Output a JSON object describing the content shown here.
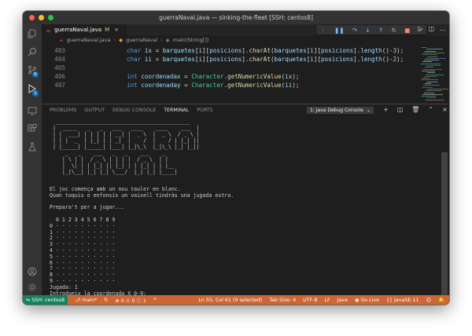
{
  "window": {
    "title": "guerraNaval.java — sinking-the-fleet [SSH: centos8]"
  },
  "tab": {
    "label": "guerraNaval.java",
    "modified": "M",
    "close": "×"
  },
  "breadcrumb": {
    "file": "guerraNaval.java",
    "class": "guerraNaval",
    "method": "main(String[])"
  },
  "activity_badges": {
    "scm": "6",
    "debug": "1"
  },
  "code_lines": [
    {
      "n": "403",
      "parts": [
        [
          "kw",
          "char "
        ],
        [
          "id",
          "ix"
        ],
        [
          "pl",
          " = "
        ],
        [
          "id",
          "barquetes"
        ],
        [
          "pl",
          "["
        ],
        [
          "id",
          "i"
        ],
        [
          "pl",
          "]["
        ],
        [
          "id",
          "posicions"
        ],
        [
          "pl",
          "]."
        ],
        [
          "fn",
          "charAt"
        ],
        [
          "pl",
          "("
        ],
        [
          "id",
          "barquetes"
        ],
        [
          "pl",
          "["
        ],
        [
          "id",
          "i"
        ],
        [
          "pl",
          "]["
        ],
        [
          "id",
          "posicions"
        ],
        [
          "pl",
          "]."
        ],
        [
          "id",
          "length"
        ],
        [
          "pl",
          "()-"
        ],
        [
          "num",
          "3"
        ],
        [
          "pl",
          ");"
        ]
      ]
    },
    {
      "n": "404",
      "parts": [
        [
          "kw",
          "char "
        ],
        [
          "id",
          "ii"
        ],
        [
          "pl",
          " = "
        ],
        [
          "id",
          "barquetes"
        ],
        [
          "pl",
          "["
        ],
        [
          "id",
          "i"
        ],
        [
          "pl",
          "]["
        ],
        [
          "id",
          "posicions"
        ],
        [
          "pl",
          "]."
        ],
        [
          "fn",
          "charAt"
        ],
        [
          "pl",
          "("
        ],
        [
          "id",
          "barquetes"
        ],
        [
          "pl",
          "["
        ],
        [
          "id",
          "i"
        ],
        [
          "pl",
          "]["
        ],
        [
          "id",
          "posicions"
        ],
        [
          "pl",
          "]."
        ],
        [
          "id",
          "length"
        ],
        [
          "pl",
          "()-"
        ],
        [
          "num",
          "2"
        ],
        [
          "pl",
          ");"
        ]
      ]
    },
    {
      "n": "405",
      "parts": []
    },
    {
      "n": "406",
      "parts": [
        [
          "kw",
          "int "
        ],
        [
          "id",
          "coordenadax"
        ],
        [
          "pl",
          " = "
        ],
        [
          "cls",
          "Character"
        ],
        [
          "pl",
          "."
        ],
        [
          "fn",
          "getNumericValue"
        ],
        [
          "pl",
          "("
        ],
        [
          "id",
          "ix"
        ],
        [
          "pl",
          ");"
        ]
      ]
    },
    {
      "n": "407",
      "parts": [
        [
          "kw",
          "int "
        ],
        [
          "id",
          "coordenaday"
        ],
        [
          "pl",
          " = "
        ],
        [
          "cls",
          "Character"
        ],
        [
          "pl",
          "."
        ],
        [
          "fn",
          "getNumericValue"
        ],
        [
          "pl",
          "("
        ],
        [
          "id",
          "ii"
        ],
        [
          "pl",
          ");"
        ]
      ]
    }
  ],
  "panel": {
    "tabs": [
      "PROBLEMS",
      "OUTPUT",
      "DEBUG CONSOLE",
      "TERMINAL",
      "PORTS"
    ],
    "active_tab": "TERMINAL",
    "terminal_select": "1: Java Debug Console"
  },
  "terminal": {
    "ascii_art": [
      "  ___________________________________________",
      " |  _____   _   _   ___   ____    ____    ___  |",
      " | |  ___| | | | | | __| |  _ \\  |  _ \\  / _ \\ |",
      " | | |  _  | |_| | | _|  |    /  |    / | |_| ||",
      " | |_____| |_____| |___| |_|\\_\\  |_|\\_\\ |_| |_||",
      "     _   _    ___   _   _    ___    _",
      "    | \\ | |  / _ \\ | | | |  / _ \\  | |",
      "    |  \\| | | |_| || |_| | | |_| | | |__",
      "    |_|\\__| |_| |_| \\___/  |_| |_| |____|"
    ],
    "lines": [
      "El joc comença amb un nou tauler en blanc.",
      "Quan toquis o enfonsis un vaixell tindràs una jugada extra.",
      "",
      "Prepara't per a jugar...",
      "",
      "  0 1 2 3 4 5 6 7 8 9",
      "0 · · · · · · · · · ·",
      "1 · · · · · · · · · ·",
      "2 · · · · · · · · · ·",
      "3 · · · · · · · · · ·",
      "4 · · · · · · · · · ·",
      "5 · · · · · · · · · ·",
      "6 · · · · · · · · · ·",
      "7 · · · · · · · · · ·",
      "8 · · · · · · · · · ·",
      "9 · · · · · · · · · ·",
      "Jugada: 1",
      "Introdueix la coordenada X 0-9:"
    ]
  },
  "status": {
    "remote": "SSH: centos8",
    "branch": "main*",
    "problems": "0",
    "warnings": "0",
    "info": "1",
    "position": "Ln 55, Col 61 (9 selected)",
    "tab_size": "Tab Size: 4",
    "encoding": "UTF-8",
    "eol": "LF",
    "language": "Java",
    "live": "Go Live",
    "jdk": "JavaSE-11"
  },
  "colors": {
    "statusbar": "#cc6633",
    "remote": "#16825d",
    "accent": "#0e70c0"
  }
}
